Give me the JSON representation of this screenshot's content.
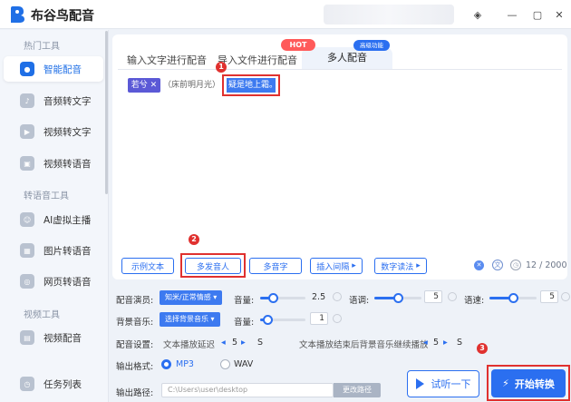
{
  "app": {
    "title": "布谷鸟配音"
  },
  "sidebar": {
    "section1": "热门工具",
    "section2": "转语音工具",
    "section3": "视频工具",
    "items": [
      {
        "label": "智能配音"
      },
      {
        "label": "音频转文字"
      },
      {
        "label": "视频转文字"
      },
      {
        "label": "视频转语音"
      },
      {
        "label": "AI虚拟主播"
      },
      {
        "label": "图片转语音"
      },
      {
        "label": "网页转语音"
      },
      {
        "label": "视频配音"
      },
      {
        "label": "任务列表"
      }
    ]
  },
  "tabs": [
    {
      "label": "输入文字进行配音"
    },
    {
      "label": "导入文件进行配音"
    },
    {
      "label": "多人配音"
    }
  ],
  "badges": {
    "hot": "HOT",
    "pro": "高级功能"
  },
  "editor": {
    "speaker_chip": "若兮 ✕",
    "text1": "（床前明月光）",
    "text2": "疑是地上霜。",
    "counter": "12 / 2000"
  },
  "toolbar": {
    "example": "示例文本",
    "multi_speaker": "多发音人",
    "polyphone": "多音字",
    "insert_pause": "插入间隔",
    "number_reading": "数字读法"
  },
  "settings": {
    "voice_label": "配音演员:",
    "voice_value": "知米/正常情感",
    "volume_label": "音量:",
    "volume_value": "2.5",
    "volume_level": 0.28,
    "pitch_label": "语调:",
    "pitch_value": "5",
    "pitch_level": 0.5,
    "speed_label": "语速:",
    "speed_value": "5",
    "speed_level": 0.5,
    "bgm_label": "背景音乐:",
    "bgm_value": "选择背景音乐",
    "bgm_volume_label": "音量:",
    "bgm_volume_value": "1",
    "bgm_volume_level": 0.15,
    "config_label": "配音设置:",
    "delay_label": "文本播放延迟",
    "delay_value": "5",
    "delay_unit": "S",
    "bgm_continue_label": "文本播放结束后背景音乐继续播放",
    "bgm_continue_value": "5",
    "bgm_continue_unit": "S",
    "format_label": "输出格式:",
    "format_mp3": "MP3",
    "format_wav": "WAV",
    "path_label": "输出路径:",
    "path_value": "C:\\Users\\user\\desktop",
    "path_button": "更改路径"
  },
  "actions": {
    "preview": "试听一下",
    "convert": "开始转换"
  },
  "annotations": [
    "1",
    "2",
    "3"
  ],
  "colors": {
    "accent": "#2b6ff0",
    "annotation": "#e0312f",
    "hot": "#ff5a5a"
  }
}
